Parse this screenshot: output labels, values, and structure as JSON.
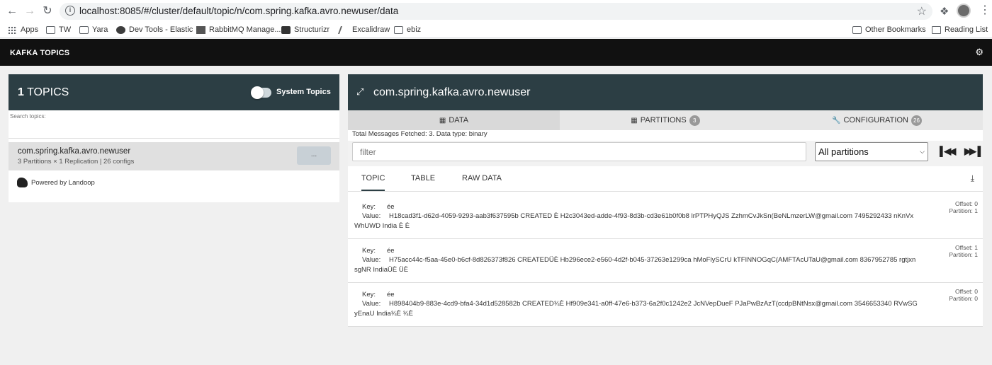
{
  "browser": {
    "url": "localhost:8085/#/cluster/default/topic/n/com.spring.kafka.avro.newuser/data",
    "bookmarks": [
      "Apps",
      "TW",
      "Yara",
      "Dev Tools - Elastic",
      "RabbitMQ Manage...",
      "Structurizr",
      "Excalidraw",
      "ebiz"
    ],
    "other_bookmarks": "Other Bookmarks",
    "reading_list": "Reading List"
  },
  "app": {
    "title": "KAFKA TOPICS"
  },
  "left": {
    "count": "1",
    "topics_label": "TOPICS",
    "system_topics_label": "System Topics",
    "system_topics_enabled": false,
    "search_placeholder": "Search topics:",
    "topics": [
      {
        "name": "com.spring.kafka.avro.newuser",
        "meta": "3 Partitions × 1 Replication | 26 configs",
        "action": "..."
      }
    ],
    "powered_by": "Powered by Landoop"
  },
  "right": {
    "topic_title": "com.spring.kafka.avro.newuser",
    "tabs": [
      {
        "label": "DATA",
        "badge": ""
      },
      {
        "label": "PARTITIONS",
        "badge": "3"
      },
      {
        "label": "CONFIGURATION",
        "badge": "26"
      }
    ],
    "fetched_text": "Total Messages Fetched: 3. Data type: binary",
    "filter_placeholder": "filter",
    "partition_select": "All partitions",
    "subtabs": [
      "TOPIC",
      "TABLE",
      "RAW DATA"
    ],
    "key_label": "Key:",
    "value_label": "Value:",
    "messages": [
      {
        "key": "ée",
        "value_line1": "H18cad3f1-d62d-4059-9293-aab3f637595b CREATED È     H2c3043ed-adde-4f93-8d3b-cd3e61b0f0b8 lrPTPHyQJS ZzhmCvJkSn(BeNLmzerLW@gmail.com 7495292433 nKnVx",
        "value_line2": "WhUWD India È      È",
        "offset": "Offset: 0",
        "partition": "Partition: 1"
      },
      {
        "key": "ée",
        "value_line1": "H75acc44c-f5aa-45e0-b6cf-8d826373f826 CREATEDÜÈ     Hb296ece2-e560-4d2f-b045-37263e1299ca hMoFlySCrU kTFINNOGqC(AMFTAcUTaU@gmail.com 8367952785 rgtjxn",
        "value_line2": "sgNR IndiaÜÈ      ÜÈ",
        "offset": "Offset: 1",
        "partition": "Partition: 1"
      },
      {
        "key": "ée",
        "value_line1": "H898404b9-883e-4cd9-bfa4-34d1d528582b CREATED¾È     Hf909e341-a0ff-47e6-b373-6a2f0c1242e2 JcNVepDueF PJaPwBzAzT(ccdpBNtNsx@gmail.com 3546653340 RVwSG",
        "value_line2": "yEnaU India¾È      ¾È",
        "offset": "Offset: 0",
        "partition": "Partition: 0"
      }
    ]
  }
}
